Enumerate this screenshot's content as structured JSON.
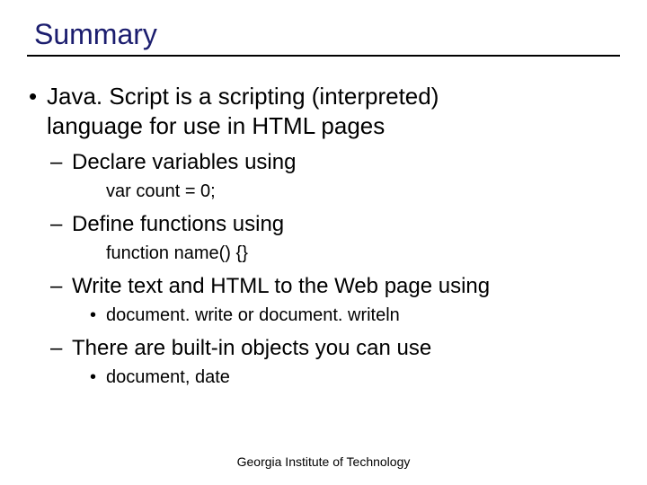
{
  "title": "Summary",
  "bullet_main": {
    "line1": "Java. Script is a scripting (interpreted)",
    "line2": "language for use in HTML pages"
  },
  "items": [
    {
      "label": "Declare variables using",
      "code": "var count = 0;"
    },
    {
      "label": "Define functions using",
      "code": "function name() {}"
    },
    {
      "label": "Write text and HTML to the Web page using",
      "sub": "document. write or document. writeln"
    },
    {
      "label": "There are built-in objects you can use",
      "sub": "document, date"
    }
  ],
  "footer": "Georgia Institute of Technology"
}
